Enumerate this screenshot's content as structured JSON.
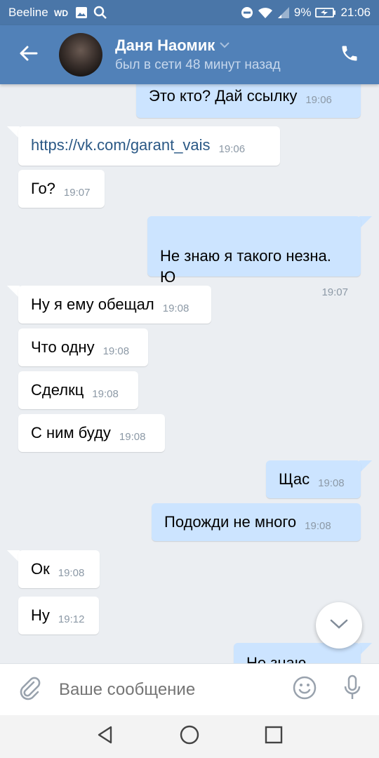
{
  "status_bar": {
    "carrier": "Beeline",
    "battery_percent": "9%",
    "time": "21:06"
  },
  "header": {
    "contact_name": "Даня Наомик",
    "last_seen": "был в сети 48 минут назад"
  },
  "colors": {
    "header": "#5181b8",
    "status_bar": "#4a76a8",
    "incoming_bubble": "#ffffff",
    "outgoing_bubble": "#cce4ff",
    "chat_background": "#ebeef2"
  },
  "messages": [
    {
      "direction": "out",
      "text": "Это кто? Дай ссылку",
      "time": "19:06"
    },
    {
      "direction": "in",
      "text": "https://vk.com/garant_vais",
      "time": "19:06",
      "is_link": true
    },
    {
      "direction": "in",
      "text": "Го?",
      "time": "19:07"
    },
    {
      "direction": "out",
      "text": "Не знаю я такого незна.\nЮ",
      "time": "19:07"
    },
    {
      "direction": "in",
      "text": "Ну я ему обещал",
      "time": "19:08"
    },
    {
      "direction": "in",
      "text": "Что одну",
      "time": "19:08"
    },
    {
      "direction": "in",
      "text": "Сделкц",
      "time": "19:08"
    },
    {
      "direction": "in",
      "text": "С ним буду",
      "time": "19:08"
    },
    {
      "direction": "out",
      "text": "Щас",
      "time": "19:08"
    },
    {
      "direction": "out",
      "text": "Подожди не много",
      "time": "19:08"
    },
    {
      "direction": "in",
      "text": "Ок",
      "time": "19:08"
    },
    {
      "direction": "in",
      "text": "Ну",
      "time": "19:12"
    },
    {
      "direction": "out",
      "text": "Не знаю",
      "time": ""
    }
  ],
  "input": {
    "placeholder": "Ваше сообщение"
  },
  "icons": {
    "back": "arrow-left-icon",
    "call": "phone-icon",
    "attach": "paperclip-icon",
    "emoji": "smiley-icon",
    "mic": "microphone-icon",
    "scroll": "chevron-down-icon",
    "nav_back": "triangle-back-icon",
    "nav_home": "circle-home-icon",
    "nav_recent": "square-recent-icon"
  }
}
